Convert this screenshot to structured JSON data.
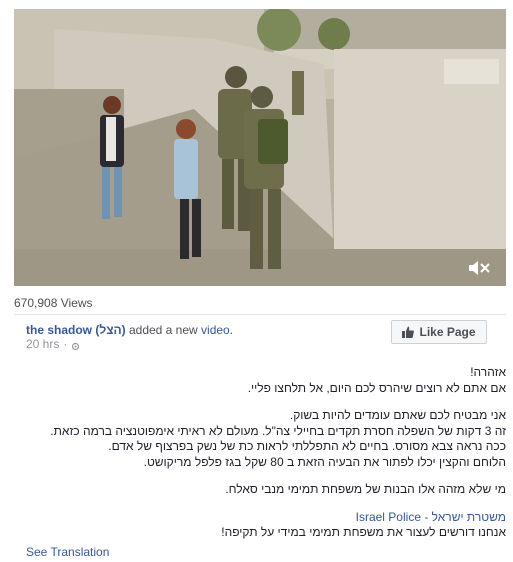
{
  "video": {
    "views": "670,908 Views"
  },
  "post": {
    "author": "the shadow (הצל)",
    "action": "added a new",
    "object": "video",
    "time": "20 hrs",
    "dot": "·",
    "like_button": "Like Page",
    "lines": {
      "l1": "אזהרה!",
      "l2": "אם אתם לא רוצים שיהרס לכם היום, אל תלחצו פליי.",
      "l3": "אני מבטיח לכם שאתם עומדים להיות בשוק.",
      "l4": "זה 3 דקות של השפלה חסרת תקדים בחיילי צה\"ל. מעולם לא ראיתי אימפוטנציה ברמה כזאת.",
      "l5": "ככה נראה צבא מסורס. בחיים לא התפללתי לראות כת של נשק בפרצוף של אדם.",
      "l6": "הלוחם והקצין יכלו לפתור את הבעיה הזאת ב 80 שקל בגז פלפל מריקושט.",
      "l7": "מי שלא מזהה אלו הבנות של משפחת תמימי מנבי סאלח.",
      "l8_link": "Israel Police - משטרת ישראל",
      "l9": "אנחנו דורשים לעצור את משפחת תמימי במידי על תקיפה!"
    },
    "see_translation": "See Translation"
  },
  "icons": {
    "mute": "speaker-muted-icon",
    "like": "thumbs-up-icon",
    "privacy": "gear-globe-icon"
  },
  "colors": {
    "link": "#365899",
    "meta": "#90949c"
  }
}
